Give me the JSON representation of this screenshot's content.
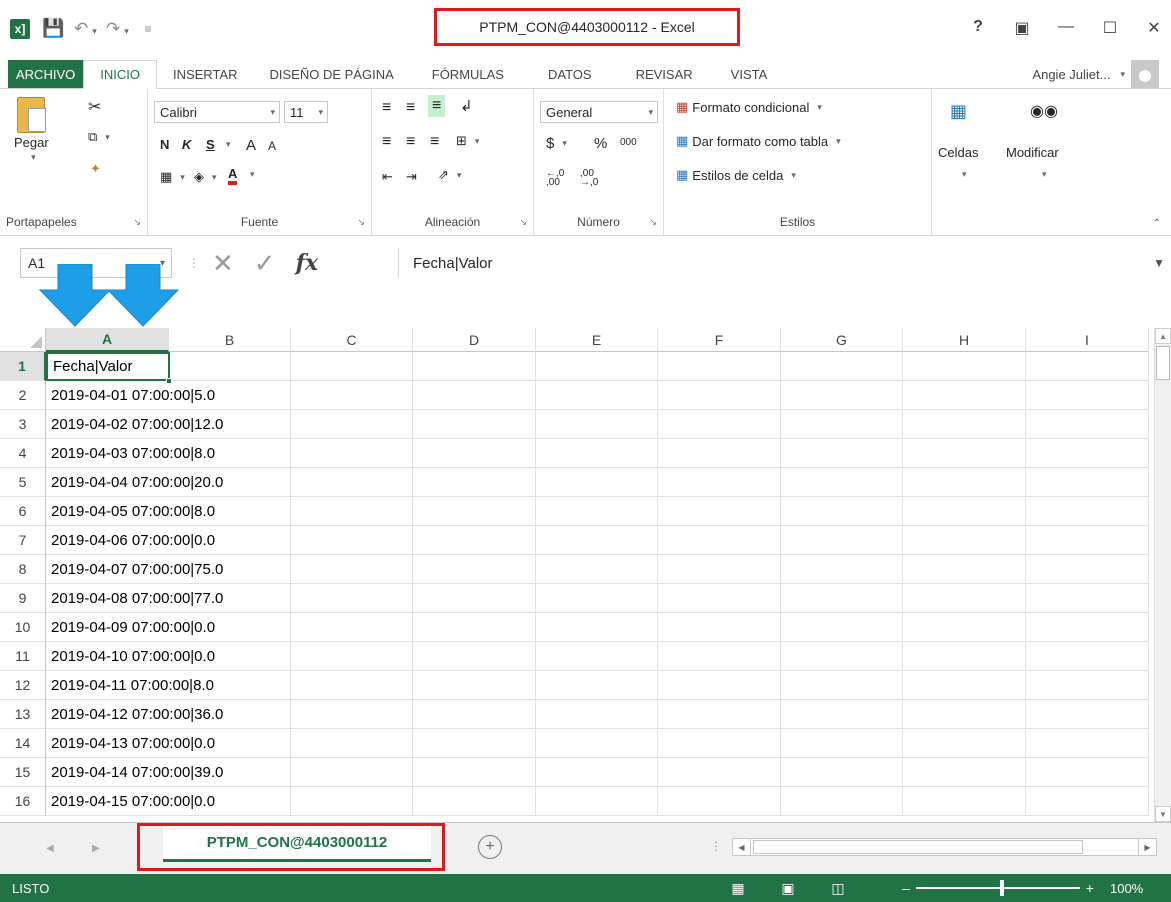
{
  "window": {
    "title": "PTPM_CON@4403000112 - Excel",
    "help": "?",
    "ribbon_display": "▣",
    "minimize": "—",
    "maximize": "☐",
    "close": "✕"
  },
  "qat": {
    "app_icon": "x]",
    "save_icon": "save-icon",
    "undo_icon": "undo-icon",
    "redo_icon": "redo-icon",
    "customize_icon": "customize-icon"
  },
  "tabs": [
    "ARCHIVO",
    "INICIO",
    "INSERTAR",
    "DISEÑO DE PÁGINA",
    "FÓRMULAS",
    "DATOS",
    "REVISAR",
    "VISTA"
  ],
  "user": {
    "name": "Angie Juliet..."
  },
  "ribbon": {
    "clipboard": {
      "paste": "Pegar",
      "label": "Portapapeles"
    },
    "font": {
      "name": "Calibri",
      "size": "11",
      "bold": "N",
      "italic": "K",
      "underline": "S",
      "grow": "A",
      "shrink": "A",
      "font_color": "A",
      "label": "Fuente"
    },
    "alignment": {
      "label": "Alineación"
    },
    "number": {
      "format": "General",
      "currency": "$",
      "percent": "%",
      "thousands": "000",
      "inc_decimal": "←,0 ,00",
      "dec_decimal": ",00 →,0",
      "label": "Número"
    },
    "styles": {
      "conditional": "Formato condicional",
      "as_table": "Dar formato como tabla",
      "cell_styles": "Estilos de celda",
      "label": "Estilos"
    },
    "cells": {
      "label": "Celdas"
    },
    "editing": {
      "label": "Modificar"
    }
  },
  "formula_bar": {
    "name_box": "A1",
    "fx": "fx",
    "content": "Fecha|Valor"
  },
  "sheet": {
    "columns": [
      "A",
      "B",
      "C",
      "D",
      "E",
      "F",
      "G",
      "H",
      "I"
    ],
    "selected_column": "A",
    "rows": [
      {
        "n": "1",
        "a": "Fecha|Valor"
      },
      {
        "n": "2",
        "a": "2019-04-01 07:00:00|5.0"
      },
      {
        "n": "3",
        "a": "2019-04-02 07:00:00|12.0"
      },
      {
        "n": "4",
        "a": "2019-04-03 07:00:00|8.0"
      },
      {
        "n": "5",
        "a": "2019-04-04 07:00:00|20.0"
      },
      {
        "n": "6",
        "a": "2019-04-05 07:00:00|8.0"
      },
      {
        "n": "7",
        "a": "2019-04-06 07:00:00|0.0"
      },
      {
        "n": "8",
        "a": "2019-04-07 07:00:00|75.0"
      },
      {
        "n": "9",
        "a": "2019-04-08 07:00:00|77.0"
      },
      {
        "n": "10",
        "a": "2019-04-09 07:00:00|0.0"
      },
      {
        "n": "11",
        "a": "2019-04-10 07:00:00|0.0"
      },
      {
        "n": "12",
        "a": "2019-04-11 07:00:00|8.0"
      },
      {
        "n": "13",
        "a": "2019-04-12 07:00:00|36.0"
      },
      {
        "n": "14",
        "a": "2019-04-13 07:00:00|0.0"
      },
      {
        "n": "15",
        "a": "2019-04-14 07:00:00|39.0"
      },
      {
        "n": "16",
        "a": "2019-04-15 07:00:00|0.0"
      }
    ]
  },
  "sheet_tabs": {
    "active": "PTPM_CON@4403000112",
    "add": "+"
  },
  "status": {
    "text": "LISTO",
    "zoom": "100%"
  },
  "colors": {
    "accent": "#217346",
    "highlight_red": "#e0191b",
    "arrow_blue": "#1f9ee8"
  }
}
